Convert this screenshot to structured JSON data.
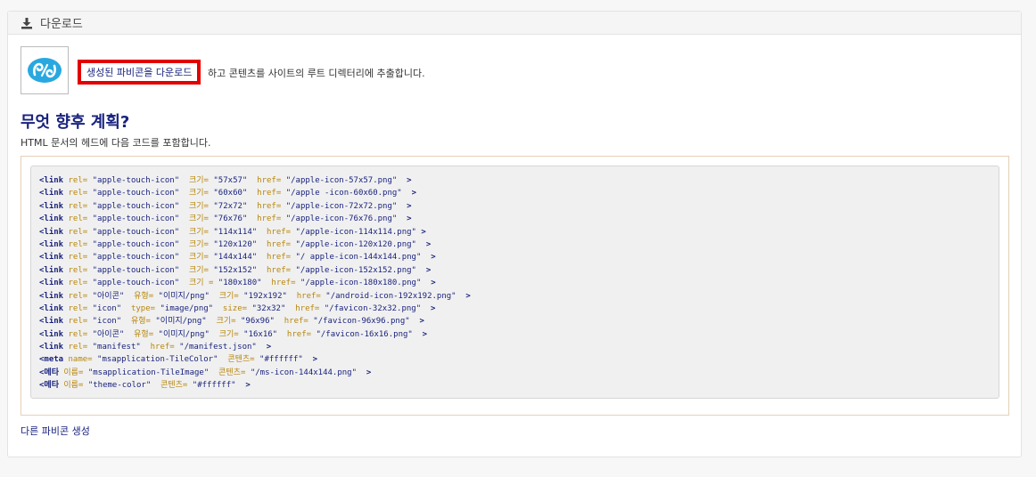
{
  "header": {
    "title": "다운로드",
    "icon": "download-icon"
  },
  "download": {
    "link_label": "생성된 파비콘을 다운로드",
    "rest_text": "하고 콘텐츠를 사이트의 루트 디렉터리에 추출합니다."
  },
  "next": {
    "heading": "무엇 향후 계획?",
    "description": "HTML 문서의 헤드에 다음 코드를 포함합니다."
  },
  "code_lines": [
    [
      "<link",
      " rel=",
      "\"apple-touch-icon\"",
      " 크기=",
      "\"57x57\"",
      " href=",
      "\"/apple-icon-57x57.png\"",
      " >"
    ],
    [
      "<link",
      " rel=",
      "\"apple-touch-icon\"",
      " 크기=",
      "\"60x60\"",
      " href=",
      "\"/apple -icon-60x60.png\"",
      " >"
    ],
    [
      "<link",
      " rel=",
      "\"apple-touch-icon\"",
      " 크기=",
      "\"72x72\"",
      " href=",
      "\"/apple-icon-72x72.png\"",
      " >"
    ],
    [
      "<link",
      " rel=",
      "\"apple-touch-icon\"",
      " 크기=",
      "\"76x76\"",
      " href=",
      "\"/apple-icon-76x76.png\"",
      " >"
    ],
    [
      "<link",
      " rel=",
      "\"apple-touch-icon\"",
      " 크기=",
      "\"114x114\"",
      " href=",
      "\"/apple-icon-114x114.png\"",
      ">"
    ],
    [
      "<link",
      " rel=",
      "\"apple-touch-icon\"",
      " 크기=",
      "\"120x120\"",
      " href=",
      "\"/apple-icon-120x120.png\"",
      " >"
    ],
    [
      "<link",
      " rel=",
      "\"apple-touch-icon\"",
      " 크기=",
      "\"144x144\"",
      " href=",
      "\"/ apple-icon-144x144.png\"",
      " >"
    ],
    [
      "<link",
      " rel=",
      "\"apple-touch-icon\"",
      " 크기=",
      "\"152x152\"",
      " href=",
      "\"/apple-icon-152x152.png\"",
      " >"
    ],
    [
      "<link",
      " rel=",
      "\"apple-touch-icon\"",
      " 크기 =",
      "\"180x180\"",
      " href=",
      "\"/apple-icon-180x180.png\"",
      " >"
    ],
    [
      "<link",
      " rel=",
      "\"아이콘\"",
      " 유형=",
      "\"이미지/png\"",
      " 크기=",
      "\"192x192\"",
      " href=",
      "\"/android-icon-192x192.png\"",
      " >"
    ],
    [
      "<link",
      " rel=",
      "\"icon\"",
      " type=",
      "\"image/png\"",
      " size=",
      "\"32x32\"",
      " href=",
      "\"/favicon-32x32.png\"",
      " >"
    ],
    [
      "<link",
      " rel=",
      "\"icon\"",
      " 유형=",
      "\"이미지/png\"",
      " 크기=",
      "\"96x96\"",
      " href=",
      "\"/favicon-96x96.png\"",
      " >"
    ],
    [
      "<link",
      " rel=",
      "\"아이콘\"",
      " 유형=",
      "\"이미지/png\"",
      " 크기=",
      "\"16x16\"",
      " href=",
      "\"/favicon-16x16.png\"",
      " >"
    ],
    [
      "<link",
      " rel=",
      "\"manifest\"",
      " href=",
      "\"/manifest.json\"",
      " >"
    ],
    [
      "<meta",
      " name=",
      "\"msapplication-TileColor\"",
      " 콘텐츠=",
      "\"#ffffff\"",
      " >"
    ],
    [
      "<메타",
      " 이름=",
      "\"msapplication-TileImage\"",
      " 콘텐츠=",
      "\"/ms-icon-144x144.png\"",
      " >"
    ],
    [
      "<메타",
      " 이름=",
      "\"theme-color\"",
      " 콘텐츠=",
      "\"#ffffff\"",
      " >"
    ]
  ],
  "other_link": "다른 파비콘 생성",
  "colors": {
    "heading": "#1a237e",
    "highlight_border": "#e30000",
    "attr": "#b8860b"
  }
}
